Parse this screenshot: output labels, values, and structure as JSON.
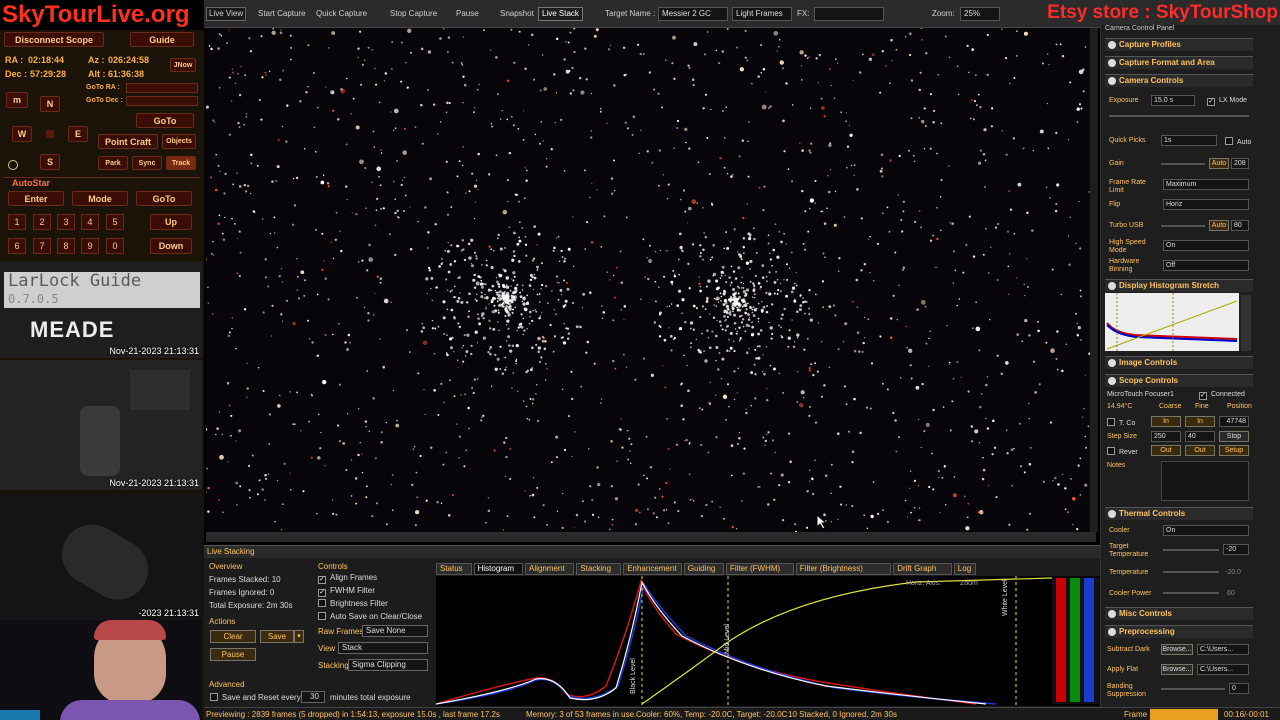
{
  "brand": "SkyTourLive.org",
  "etsy": "Etsy store : SkyTourShop",
  "scope": {
    "disconnect": "Disconnect Scope",
    "guide": "Guide",
    "ra_label": "RA :",
    "ra": "02:18:44",
    "az_label": "Az :",
    "az": "026:24:58",
    "dec_label": "Dec :",
    "dec": "57:29:28",
    "alt_label": "Alt :",
    "alt": "61:36:38",
    "jnow": "JNow",
    "goto_ra": "GoTo RA :",
    "goto_dec": "GoTo Dec :",
    "goto": "GoTo",
    "point_craft": "Point Craft",
    "objects": "Objects",
    "park": "Park",
    "sync": "Sync",
    "track": "Track",
    "m": "m",
    "n": "N",
    "w": "W",
    "e": "E",
    "s": "S"
  },
  "autostar": {
    "title": "AutoStar",
    "enter": "Enter",
    "mode": "Mode",
    "goto": "GoTo",
    "up": "Up",
    "down": "Down",
    "digits": [
      "1",
      "2",
      "3",
      "4",
      "5",
      "6",
      "7",
      "8",
      "9",
      "0"
    ]
  },
  "cams": {
    "lcd_line": "LarLock Guide",
    "lcd_sub": "0.7.0.5",
    "meade": "MEADE",
    "ts1": "Nov-21-2023 21:13:31",
    "ts2": "Nov-21-2023 21:13:31",
    "ts3": "-2023 21:13:31"
  },
  "toolbar": {
    "live_view": "Live View",
    "start_capture": "Start Capture",
    "quick_capture": "Quick Capture",
    "stop_capture": "Stop Capture",
    "pause": "Pause",
    "snapshot": "Snapshot",
    "live_stack": "Live Stack",
    "target_label": "Target Name :",
    "target": "Messier 2 GC",
    "frame_type": "Light Frames",
    "fx": "FX:",
    "zoom_label": "Zoom:",
    "zoom": "25%"
  },
  "stack": {
    "title": "Live Stacking",
    "overview": "Overview",
    "frames_stacked": "Frames Stacked: 10",
    "frames_ignored": "Frames Ignored: 0",
    "total_exposure": "Total Exposure: 2m 30s",
    "actions": "Actions",
    "clear": "Clear",
    "save": "Save",
    "pause": "Pause",
    "advanced": "Advanced",
    "save_reset": "Save and Reset every",
    "save_reset_val": "30",
    "save_reset_suffix": "minutes total exposure",
    "controls": "Controls",
    "align": "Align Frames",
    "fwhm": "FWHM Filter",
    "brightness": "Brightness Filter",
    "autosave": "Auto Save on Clear/Close",
    "raw_label": "Raw Frames",
    "raw": "Save None",
    "view_label": "View",
    "view": "Stack",
    "stacking_label": "Stacking",
    "stacking": "Sigma Clipping",
    "tabs": [
      "Status",
      "Histogram",
      "Alignment",
      "Stacking",
      "Enhancement",
      "Guiding",
      "Filter (FWHM)",
      "Filter (Brightness)",
      "Drift Graph",
      "Log"
    ],
    "horiz_axis": "Horiz. Axis:",
    "zoom": "Zoom",
    "black_level": "Black Level",
    "mid_level": "Mid Level",
    "white_level": "White Level"
  },
  "right": {
    "panel_title": "Camera Control Panel",
    "capture_profiles": "Capture Profiles",
    "capture_format": "Capture Format and Area",
    "camera_controls": "Camera Controls",
    "exposure_label": "Exposure",
    "exposure": "15.0 s",
    "lx_mode": "LX Mode",
    "quick_picks_label": "Quick Picks",
    "quick_picks": "1s",
    "auto": "Auto",
    "gain_label": "Gain",
    "gain_auto": "Auto",
    "gain": "208",
    "frame_rate_label": "Frame Rate Limit",
    "frame_rate": "Maximum",
    "flip_label": "Flip",
    "flip": "Horiz",
    "turbo_label": "Turbo USB",
    "turbo_auto": "Auto",
    "turbo": "80",
    "hsm_label": "High Speed Mode",
    "hsm": "On",
    "hb_label": "Hardware Binning",
    "hb": "Off",
    "display_hist": "Display Histogram Stretch",
    "image_controls": "Image Controls",
    "scope_controls": "Scope Controls",
    "focuser": "MicroTouch Focuser1",
    "connected": "Connected",
    "temp": "14.94°C",
    "coarse": "Coarse",
    "fine": "Fine",
    "position_label": "Position",
    "tcomp": "T. Co",
    "in1": "In",
    "in2": "In",
    "position": "47748",
    "step_label": "Step Size",
    "step1": "250",
    "step2": "40",
    "stop": "Stop",
    "reverse": "Rever",
    "out1": "Out",
    "out2": "Out",
    "setup": "Setup",
    "notes": "Notes",
    "thermal": "Thermal Controls",
    "cooler_label": "Cooler",
    "cooler": "On",
    "target_temp_label": "Target Temperature",
    "target_temp": "-20",
    "temperature_label": "Temperature",
    "temperature": "-20.0",
    "cooler_power_label": "Cooler Power",
    "cooler_power": "60",
    "misc": "Misc Controls",
    "preprocessing": "Preprocessing",
    "dark_label": "Subtract Dark",
    "browse": "Browse...",
    "path": "C:\\Users...",
    "flat_label": "Apply Flat",
    "banding_label": "Banding Suppression",
    "banding": "0"
  },
  "status": {
    "preview": "Previewing : 2839 frames (5 dropped) in 1:54:13, exposure 15.0s , last frame 17.2s",
    "memory": "Memory: 3 of 53 frames in use.",
    "cooler": "Cooler: 60%, Temp: -20.0C, Target: -20.0C",
    "stacked": "10 Stacked, 0 Ignored, 2m 30s",
    "frame_label": "Frame :",
    "frame_time": "00:16/-00:01"
  }
}
